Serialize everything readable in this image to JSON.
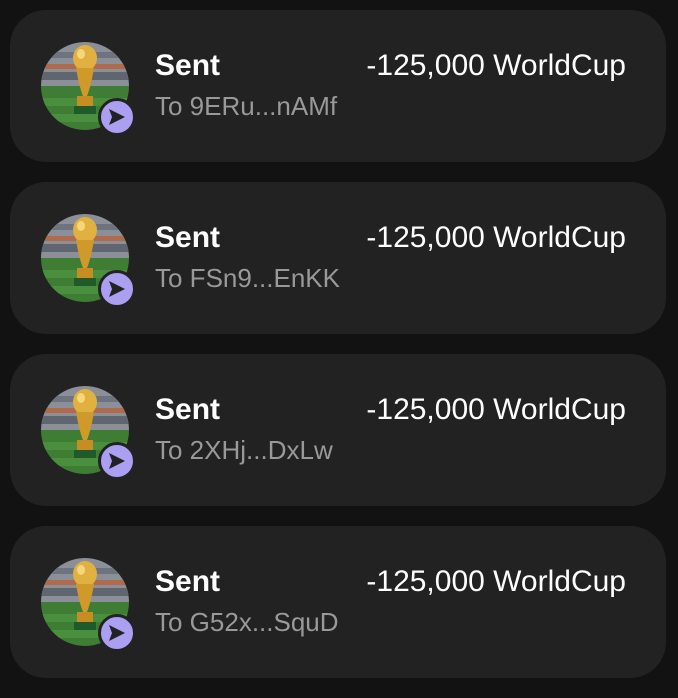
{
  "transactions": [
    {
      "type_label": "Sent",
      "amount": "-125,000 WorldCup",
      "recipient": "To 9ERu...nAMf",
      "token_image": "world-cup-trophy",
      "status_icon": "send-arrow-icon"
    },
    {
      "type_label": "Sent",
      "amount": "-125,000 WorldCup",
      "recipient": "To FSn9...EnKK",
      "token_image": "world-cup-trophy",
      "status_icon": "send-arrow-icon"
    },
    {
      "type_label": "Sent",
      "amount": "-125,000 WorldCup",
      "recipient": "To 2XHj...DxLw",
      "token_image": "world-cup-trophy",
      "status_icon": "send-arrow-icon"
    },
    {
      "type_label": "Sent",
      "amount": "-125,000 WorldCup",
      "recipient": "To G52x...SquD",
      "token_image": "world-cup-trophy",
      "status_icon": "send-arrow-icon"
    }
  ],
  "colors": {
    "background": "#121212",
    "card": "#222222",
    "primary_text": "#ffffff",
    "secondary_text": "#999999",
    "accent": "#ab9ff2"
  }
}
